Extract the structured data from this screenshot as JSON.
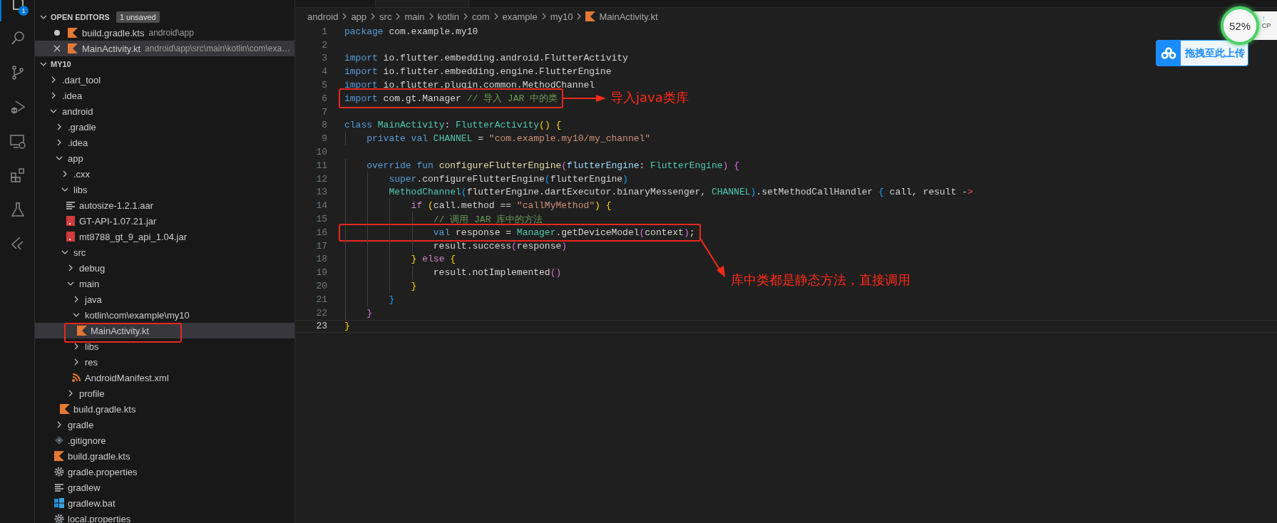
{
  "activity_bar": {
    "items": [
      {
        "kind": "explorer",
        "selected": true,
        "badge": "1"
      },
      {
        "kind": "search",
        "selected": false
      },
      {
        "kind": "source-control",
        "selected": false
      },
      {
        "kind": "run-debug",
        "selected": false
      },
      {
        "kind": "remote",
        "selected": false
      },
      {
        "kind": "extensions",
        "selected": false
      },
      {
        "kind": "testing",
        "selected": false
      },
      {
        "kind": "flutter",
        "selected": false
      }
    ]
  },
  "sidebar": {
    "open_editors": {
      "title": "OPEN EDITORS",
      "expanded": true,
      "badge": "1 unsaved",
      "items": [
        {
          "name": "build.gradle.kts",
          "path": "android\\app",
          "modified": true,
          "selected": false
        },
        {
          "name": "MainActivity.kt",
          "path": "android\\app\\src\\main\\kotlin\\com\\exa…",
          "modified": false,
          "selected": true
        }
      ]
    },
    "project": {
      "title": "MY10",
      "expanded": true
    },
    "tree": [
      {
        "name": ".dart_tool",
        "kind": "folder",
        "expanded": false,
        "selected": false,
        "highlighted": false
      },
      {
        "name": ".idea",
        "kind": "folder",
        "expanded": false,
        "selected": false,
        "highlighted": false
      },
      {
        "name": "android",
        "kind": "folder",
        "expanded": true,
        "selected": false,
        "highlighted": false,
        "children": [
          {
            "name": ".gradle",
            "kind": "folder",
            "expanded": false,
            "selected": false,
            "highlighted": false
          },
          {
            "name": ".idea",
            "kind": "folder",
            "expanded": false,
            "selected": false,
            "highlighted": false
          },
          {
            "name": "app",
            "kind": "folder",
            "expanded": true,
            "selected": false,
            "highlighted": false,
            "children": [
              {
                "name": ".cxx",
                "kind": "folder",
                "expanded": false,
                "selected": false,
                "highlighted": false
              },
              {
                "name": "libs",
                "kind": "folder",
                "expanded": true,
                "selected": false,
                "highlighted": false,
                "children": [
                  {
                    "name": "autosize-1.2.1.aar",
                    "kind": "text",
                    "selected": false,
                    "highlighted": false
                  },
                  {
                    "name": "GT-API-1.07.21.jar",
                    "kind": "jar",
                    "selected": false,
                    "highlighted": false
                  },
                  {
                    "name": "mt8788_gt_9_api_1.04.jar",
                    "kind": "jar",
                    "selected": false,
                    "highlighted": false
                  }
                ]
              },
              {
                "name": "src",
                "kind": "folder",
                "expanded": true,
                "selected": false,
                "highlighted": false,
                "children": [
                  {
                    "name": "debug",
                    "kind": "folder",
                    "expanded": false,
                    "selected": false,
                    "highlighted": false
                  },
                  {
                    "name": "main",
                    "kind": "folder",
                    "expanded": true,
                    "selected": false,
                    "highlighted": false,
                    "children": [
                      {
                        "name": "java",
                        "kind": "folder",
                        "expanded": false,
                        "selected": false,
                        "highlighted": false
                      },
                      {
                        "name": "kotlin\\com\\example\\my10",
                        "kind": "folder",
                        "expanded": true,
                        "selected": false,
                        "highlighted": false,
                        "children": [
                          {
                            "name": "MainActivity.kt",
                            "kind": "kotlin",
                            "selected": true,
                            "highlighted": true
                          }
                        ]
                      },
                      {
                        "name": "libs",
                        "kind": "folder",
                        "expanded": false,
                        "selected": false,
                        "highlighted": false
                      },
                      {
                        "name": "res",
                        "kind": "folder",
                        "expanded": false,
                        "selected": false,
                        "highlighted": false
                      },
                      {
                        "name": "AndroidManifest.xml",
                        "kind": "xml",
                        "selected": false,
                        "highlighted": false
                      }
                    ]
                  },
                  {
                    "name": "profile",
                    "kind": "folder",
                    "expanded": false,
                    "selected": false,
                    "highlighted": false
                  }
                ]
              },
              {
                "name": "build.gradle.kts",
                "kind": "kotlin",
                "selected": false,
                "highlighted": false
              }
            ]
          },
          {
            "name": "gradle",
            "kind": "folder",
            "expanded": false,
            "selected": false,
            "highlighted": false
          },
          {
            "name": ".gitignore",
            "kind": "git",
            "selected": false,
            "highlighted": false
          },
          {
            "name": "build.gradle.kts",
            "kind": "kotlin",
            "selected": false,
            "highlighted": false
          },
          {
            "name": "gradle.properties",
            "kind": "gear",
            "selected": false,
            "highlighted": false
          },
          {
            "name": "gradlew",
            "kind": "text",
            "selected": false,
            "highlighted": false
          },
          {
            "name": "gradlew.bat",
            "kind": "windows",
            "selected": false,
            "highlighted": false
          },
          {
            "name": "local.properties",
            "kind": "gear",
            "selected": false,
            "highlighted": false
          }
        ]
      }
    ]
  },
  "editor": {
    "tabs": [
      {
        "selected": false
      },
      {
        "selected": true
      }
    ],
    "breadcrumb": [
      {
        "text": "android",
        "kind": "folder"
      },
      {
        "text": "app",
        "kind": "folder"
      },
      {
        "text": "src",
        "kind": "folder"
      },
      {
        "text": "main",
        "kind": "folder"
      },
      {
        "text": "kotlin",
        "kind": "folder"
      },
      {
        "text": "com",
        "kind": "folder"
      },
      {
        "text": "example",
        "kind": "folder"
      },
      {
        "text": "my10",
        "kind": "folder"
      },
      {
        "text": "MainActivity.kt",
        "kind": "kotlin"
      }
    ],
    "lines": [
      {
        "number": "1",
        "current": false,
        "tokens": [
          {
            "kind": "kw",
            "text": "package"
          },
          {
            "kind": "plain",
            "text": " com.example.my10"
          }
        ]
      },
      {
        "number": "2",
        "current": false
      },
      {
        "number": "3",
        "current": false,
        "tokens": [
          {
            "kind": "kw",
            "text": "import"
          },
          {
            "kind": "plain",
            "text": " io.flutter.embedding.android.FlutterActivity"
          }
        ]
      },
      {
        "number": "4",
        "current": false,
        "tokens": [
          {
            "kind": "kw",
            "text": "import"
          },
          {
            "kind": "plain",
            "text": " io.flutter.embedding.engine.FlutterEngine"
          }
        ]
      },
      {
        "number": "5",
        "current": false,
        "tokens": [
          {
            "kind": "kw",
            "text": "import"
          },
          {
            "kind": "plain",
            "text": " io.flutter.plugin.common.MethodChannel"
          }
        ]
      },
      {
        "number": "6",
        "current": false,
        "tokens": [
          {
            "kind": "kw",
            "text": "import"
          },
          {
            "kind": "plain",
            "text": " com.gt.Manager "
          },
          {
            "kind": "cmt",
            "text": "// 导入 JAR 中的类"
          }
        ],
        "annotation": {
          "kind": "arrow-right",
          "text": "导入java类库"
        }
      },
      {
        "number": "7",
        "current": false
      },
      {
        "number": "8",
        "current": false,
        "tokens": [
          {
            "kind": "kw",
            "text": "class"
          },
          {
            "kind": "type",
            "text": " MainActivity"
          },
          {
            "kind": "plain",
            "text": ": "
          },
          {
            "kind": "type",
            "text": "FlutterActivity"
          },
          {
            "kind": "b1",
            "text": "() {"
          }
        ]
      },
      {
        "number": "9",
        "current": false,
        "tokens": [
          {
            "kind": "kw",
            "text": "    private val"
          },
          {
            "kind": "type",
            "text": " CHANNEL"
          },
          {
            "kind": "plain",
            "text": " = "
          },
          {
            "kind": "str",
            "text": "\"com.example.my10/my_channel\""
          }
        ]
      },
      {
        "number": "10",
        "current": false
      },
      {
        "number": "11",
        "current": false,
        "tokens": [
          {
            "kind": "kw",
            "text": "    override fun"
          },
          {
            "kind": "fn",
            "text": " configureFlutterEngine"
          },
          {
            "kind": "b2",
            "text": "("
          },
          {
            "kind": "var",
            "text": "flutterEngine"
          },
          {
            "kind": "plain",
            "text": ": "
          },
          {
            "kind": "type",
            "text": "FlutterEngine"
          },
          {
            "kind": "b2",
            "text": ")"
          },
          {
            "kind": "b2",
            "text": " {"
          }
        ]
      },
      {
        "number": "12",
        "current": false,
        "tokens": [
          {
            "kind": "kw",
            "text": "        super"
          },
          {
            "kind": "plain",
            "text": ".configureFlutterEngine"
          },
          {
            "kind": "b3",
            "text": "("
          },
          {
            "kind": "plain",
            "text": "flutterEngine"
          },
          {
            "kind": "b3",
            "text": ")"
          }
        ]
      },
      {
        "number": "13",
        "current": false,
        "tokens": [
          {
            "kind": "type",
            "text": "        MethodChannel"
          },
          {
            "kind": "b3",
            "text": "("
          },
          {
            "kind": "plain",
            "text": "flutterEngine.dartExecutor.binaryMessenger, "
          },
          {
            "kind": "type",
            "text": "CHANNEL"
          },
          {
            "kind": "b3",
            "text": ")"
          },
          {
            "kind": "plain",
            "text": ".setMethodCallHandler "
          },
          {
            "kind": "b3",
            "text": "{"
          },
          {
            "kind": "plain",
            "text": " call, result -"
          },
          {
            "kind": "err",
            "text": ">"
          }
        ]
      },
      {
        "number": "14",
        "current": false,
        "tokens": [
          {
            "kind": "ctrl",
            "text": "            if"
          },
          {
            "kind": "b1",
            "text": " ("
          },
          {
            "kind": "plain",
            "text": "call.method == "
          },
          {
            "kind": "str",
            "text": "\"callMyMethod\""
          },
          {
            "kind": "b1",
            "text": ")"
          },
          {
            "kind": "b1",
            "text": " {"
          }
        ]
      },
      {
        "number": "15",
        "current": false,
        "tokens": [
          {
            "kind": "cmt",
            "text": "                // 调用 JAR 库中的方法"
          }
        ]
      },
      {
        "number": "16",
        "current": false,
        "tokens": [
          {
            "kind": "kw",
            "text": "                val"
          },
          {
            "kind": "plain",
            "text": " response = "
          },
          {
            "kind": "type",
            "text": "Manager"
          },
          {
            "kind": "plain",
            "text": ".getDeviceModel"
          },
          {
            "kind": "b2",
            "text": "("
          },
          {
            "kind": "plain",
            "text": "context"
          },
          {
            "kind": "b2",
            "text": ")"
          },
          {
            "kind": "plain",
            "text": ";"
          }
        ],
        "annotation": {
          "kind": "arrow-down",
          "text": "库中类都是静态方法，直接调用"
        }
      },
      {
        "number": "17",
        "current": false,
        "tokens": [
          {
            "kind": "plain",
            "text": "                result.success"
          },
          {
            "kind": "b2",
            "text": "("
          },
          {
            "kind": "plain",
            "text": "response"
          },
          {
            "kind": "b2",
            "text": ")"
          }
        ]
      },
      {
        "number": "18",
        "current": false,
        "tokens": [
          {
            "kind": "b1",
            "text": "            }"
          },
          {
            "kind": "ctrl",
            "text": " else"
          },
          {
            "kind": "b1",
            "text": " {"
          }
        ]
      },
      {
        "number": "19",
        "current": false,
        "tokens": [
          {
            "kind": "plain",
            "text": "                result.notImplemented"
          },
          {
            "kind": "b2",
            "text": "()"
          }
        ]
      },
      {
        "number": "20",
        "current": false,
        "tokens": [
          {
            "kind": "b1",
            "text": "            }"
          }
        ]
      },
      {
        "number": "21",
        "current": false,
        "tokens": [
          {
            "kind": "b3",
            "text": "        }"
          }
        ]
      },
      {
        "number": "22",
        "current": false,
        "tokens": [
          {
            "kind": "b2",
            "text": "    }"
          }
        ]
      },
      {
        "number": "23",
        "current": true,
        "tokens": [
          {
            "kind": "b1",
            "text": "}"
          }
        ]
      }
    ]
  },
  "cpu_widget": {
    "percent": "52%",
    "arrow": "↑",
    "label": "CP"
  },
  "upload_button": {
    "label": "拖拽至此上传"
  }
}
